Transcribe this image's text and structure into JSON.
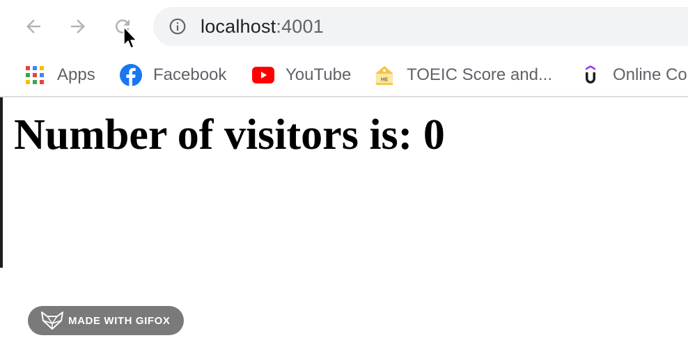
{
  "browser": {
    "url_host": "localhost",
    "url_port": ":4001",
    "nav_icons": [
      "back-arrow-icon",
      "forward-arrow-icon",
      "reload-icon",
      "info-icon"
    ]
  },
  "bookmarks": [
    {
      "label": "Apps",
      "icon": "apps-grid-icon"
    },
    {
      "label": "Facebook",
      "icon": "facebook-icon"
    },
    {
      "label": "YouTube",
      "icon": "youtube-icon"
    },
    {
      "label": "TOEIC Score and...",
      "icon": "toeic-icon"
    },
    {
      "label": "Online Co",
      "icon": "udemy-icon"
    }
  ],
  "page": {
    "heading": "Number of visitors is: 0"
  },
  "watermark": {
    "label": "MADE WITH GIFOX"
  },
  "colors": {
    "omnibox_bg": "#f1f3f4",
    "bookmark_text": "#5f6368",
    "facebook": "#1877f2",
    "youtube": "#ff0000",
    "watermark_bg": "#7a7a7a"
  }
}
